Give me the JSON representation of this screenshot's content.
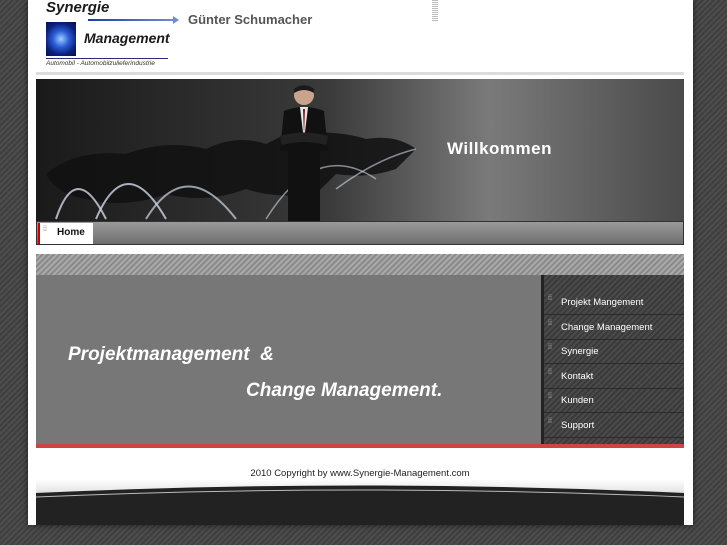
{
  "header": {
    "logo_title": "Synergie",
    "logo_management": "Management",
    "logo_subtitle": "Automobil - Automobilzulieferindustrie",
    "owner_name": "Günter Schumacher"
  },
  "banner": {
    "welcome": "Willkommen"
  },
  "nav": {
    "items": [
      {
        "label": "Home",
        "active": true
      }
    ]
  },
  "content": {
    "tagline_line1": "Projektmanagement  &",
    "tagline_line2": "Change Management."
  },
  "sidebar": {
    "items": [
      {
        "label": "Projekt Mangement"
      },
      {
        "label": "Change Management"
      },
      {
        "label": "Synergie"
      },
      {
        "label": "Kontakt"
      },
      {
        "label": "Kunden"
      },
      {
        "label": "Support"
      }
    ]
  },
  "footer": {
    "copyright": "2010 Copyright by www.Synergie-Management.com"
  },
  "colors": {
    "accent_red": "#c44444",
    "content_gray": "#777777",
    "sidebar_dark": "#404040"
  },
  "icons": {
    "nav_bullet": "small-bullet-icon"
  }
}
